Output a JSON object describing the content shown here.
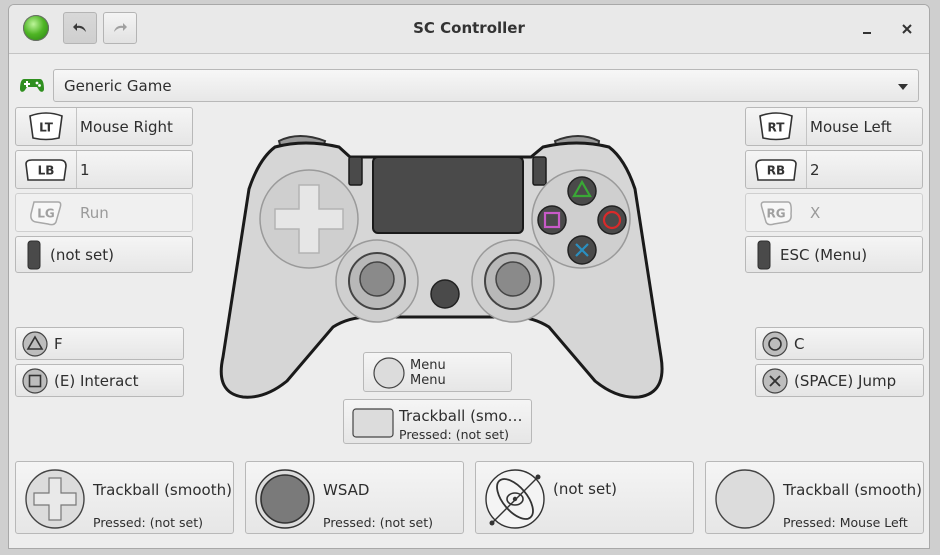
{
  "window": {
    "title": "SC Controller"
  },
  "toolbar": {
    "undo_icon": "undo-icon",
    "redo_icon": "redo-icon"
  },
  "profile": {
    "selected": "Generic Game",
    "icon": "gamepad-icon"
  },
  "left": {
    "lt": {
      "badge": "LT",
      "label": "Mouse Right"
    },
    "lb": {
      "badge": "LB",
      "label": "1"
    },
    "lg": {
      "badge": "LG",
      "label": "Run"
    },
    "lstick": {
      "label": "(not set)"
    },
    "triangle": {
      "label": "F"
    },
    "square": {
      "label": "(E) Interact"
    }
  },
  "right": {
    "rt": {
      "badge": "RT",
      "label": "Mouse Left"
    },
    "rb": {
      "badge": "RB",
      "label": "2"
    },
    "rg": {
      "badge": "RG",
      "label": "X"
    },
    "rstick": {
      "label": "ESC (Menu)"
    },
    "circle": {
      "label": "C"
    },
    "cross": {
      "label": "(SPACE) Jump"
    }
  },
  "center": {
    "menu": {
      "line1": "Menu",
      "line2": "Menu"
    },
    "touchpad": {
      "line1": "Trackball (smo…",
      "line2": "Pressed: (not set)"
    }
  },
  "bottom": {
    "dpad": {
      "title": "Trackball (smooth)",
      "sub": "Pressed: (not set)"
    },
    "stick": {
      "title": "WSAD",
      "sub": "Pressed: (not set)"
    },
    "gyro": {
      "title": "(not set)"
    },
    "rpad": {
      "title": "Trackball (smooth)",
      "sub": "Pressed: Mouse Left"
    }
  },
  "colors": {
    "triangle": "#3aa836",
    "circle": "#d92a2a",
    "cross": "#2a8fc0",
    "square": "#c85ac8"
  }
}
